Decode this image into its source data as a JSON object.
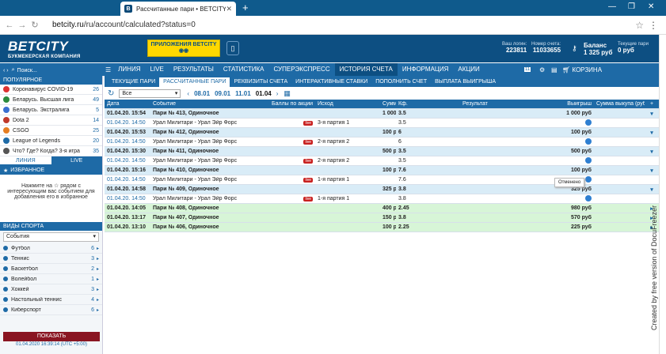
{
  "browser": {
    "tab_title": "Рассчитанные пари • BETCITY",
    "favicon": "B",
    "url_host": "betcity.ru",
    "url_path": "/ru/account/calculated?status=0"
  },
  "site": {
    "logo": "BETCITY",
    "logo_sub": "БУКМЕКЕРСКАЯ КОМПАНИЯ",
    "apps_label": "ПРИЛОЖЕНИЯ BETCITY",
    "login_label": "Ваш логин:",
    "login_value": "223811",
    "account_label": "Номер счета:",
    "account_value": "11033655",
    "balance_label": "Баланс",
    "balance_value": "1 325 руб",
    "current_bets_label": "Текущие пари",
    "current_bets_value": "0 руб"
  },
  "nav": {
    "items": [
      "ЛИНИЯ",
      "LIVE",
      "РЕЗУЛЬТАТЫ",
      "СТАТИСТИКА",
      "СУПЕРЭКСПРЕСС",
      "ИСТОРИЯ СЧЕТА",
      "ИНФОРМАЦИЯ",
      "АКЦИИ"
    ],
    "count": "11",
    "cart": "КОРЗИНА"
  },
  "sidebar": {
    "search": "Поиск...",
    "popular_title": "ПОПУЛЯРНОЕ",
    "popular": [
      {
        "label": "Коронавирус COVID-19",
        "count": "26"
      },
      {
        "label": "Беларусь. Высшая лига",
        "count": "49"
      },
      {
        "label": "Беларусь. Экстралига",
        "count": "5"
      },
      {
        "label": "Dota 2",
        "count": "14"
      },
      {
        "label": "CSGO",
        "count": "25"
      },
      {
        "label": "League of Legends",
        "count": "20"
      },
      {
        "label": "Что? Где? Когда? 3-я игра",
        "count": "35"
      }
    ],
    "tab_line": "ЛИНИЯ",
    "tab_live": "LIVE",
    "favorites_title": "ИЗБРАННОЕ",
    "favorites_text": "Нажмите на ☆ рядом с интересующим вас событием для добавления его в избранное",
    "sports_title": "ВИДЫ СПОРТА",
    "sports_select": "События",
    "sports": [
      {
        "label": "Футбол",
        "count": "6"
      },
      {
        "label": "Теннис",
        "count": "3"
      },
      {
        "label": "Баскетбол",
        "count": "2"
      },
      {
        "label": "Волейбол",
        "count": "1"
      },
      {
        "label": "Хоккей",
        "count": "3"
      },
      {
        "label": "Настольный теннис",
        "count": "4"
      },
      {
        "label": "Киберспорт",
        "count": "6"
      }
    ],
    "show_button": "ПОКАЗАТЬ",
    "timestamp": "01.04.2020 16:39:14 (UTC +5:00)"
  },
  "content": {
    "subtabs": [
      "ТЕКУЩИЕ ПАРИ",
      "РАССЧИТАННЫЕ ПАРИ",
      "РЕКВИЗИТЫ СЧЕТА",
      "ИНТЕРАКТИВНЫЕ СТАВКИ",
      "ПОПОЛНИТЬ СЧЕТ",
      "ВЫПЛАТА ВЫИГРЫША"
    ],
    "filter_value": "Все",
    "dates": [
      "08.01",
      "09.01",
      "11.01",
      "01.04"
    ],
    "columns": [
      "Дата",
      "Событие",
      "Баллы по акции",
      "Исход",
      "Сумма",
      "Кф.",
      "Результат",
      "Выигрыш",
      "Сумма выкупа (руб)",
      "+"
    ],
    "rows": [
      {
        "type": "bet",
        "date": "01.04.20. 15:54",
        "event": "Пари № 413, Одиночное",
        "outcome": "",
        "sum": "1 000 руб",
        "kf": "3.5",
        "win": "1 000 руб"
      },
      {
        "type": "ev",
        "date": "01.04.20. 14:50",
        "event": "Урал Милитари - Урал Эйр Форс",
        "outcome": "3-я партия 1",
        "sum": "",
        "kf": "3.5",
        "win": ""
      },
      {
        "type": "bet",
        "date": "01.04.20. 15:53",
        "event": "Пари № 412, Одиночное",
        "outcome": "",
        "sum": "100 руб",
        "kf": "6",
        "win": "100 руб"
      },
      {
        "type": "ev",
        "date": "01.04.20. 14:50",
        "event": "Урал Милитари - Урал Эйр Форс",
        "outcome": "2-я партия 2",
        "sum": "",
        "kf": "6",
        "win": ""
      },
      {
        "type": "bet",
        "date": "01.04.20. 15:30",
        "event": "Пари № 411, Одиночное",
        "outcome": "",
        "sum": "500 руб",
        "kf": "3.5",
        "win": "500 руб"
      },
      {
        "type": "ev",
        "date": "01.04.20. 14:50",
        "event": "Урал Милитари - Урал Эйр Форс",
        "outcome": "2-я партия 2",
        "sum": "",
        "kf": "3.5",
        "win": ""
      },
      {
        "type": "bet",
        "date": "01.04.20. 15:16",
        "event": "Пари № 410, Одиночное",
        "outcome": "",
        "sum": "100 руб",
        "kf": "7.6",
        "win": "100 руб"
      },
      {
        "type": "ev",
        "date": "01.04.20. 14:50",
        "event": "Урал Милитари - Урал Эйр Форс",
        "outcome": "1-я партия 1",
        "sum": "",
        "kf": "7.6",
        "win": ""
      },
      {
        "type": "bet",
        "date": "01.04.20. 14:58",
        "event": "Пари № 409, Одиночное",
        "outcome": "",
        "sum": "325 руб",
        "kf": "3.8",
        "win": "325 руб"
      },
      {
        "type": "ev",
        "date": "01.04.20. 14:50",
        "event": "Урал Милитари - Урал Эйр Форс",
        "outcome": "1-я партия 1",
        "sum": "",
        "kf": "3.8",
        "win": ""
      },
      {
        "type": "win",
        "date": "01.04.20. 14:05",
        "event": "Пари № 408, Одиночное",
        "outcome": "",
        "sum": "400 руб",
        "kf": "2.45",
        "win": "980 руб"
      },
      {
        "type": "win",
        "date": "01.04.20. 13:17",
        "event": "Пари № 407, Одиночное",
        "outcome": "",
        "sum": "150 руб",
        "kf": "3.8",
        "win": "570 руб"
      },
      {
        "type": "win",
        "date": "01.04.20. 13:10",
        "event": "Пари № 406, Одиночное",
        "outcome": "",
        "sum": "100 руб",
        "kf": "2.25",
        "win": "225 руб"
      }
    ],
    "tooltip": "Отменено",
    "live_badge": "live"
  },
  "side_caption": "Created by free version of DocuFreezer"
}
